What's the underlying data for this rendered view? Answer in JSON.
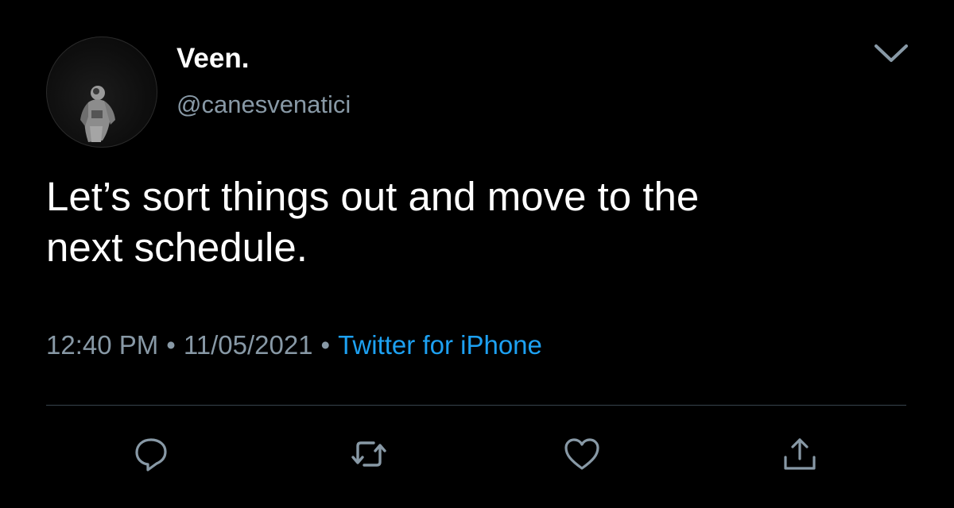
{
  "tweet": {
    "display_name": "Veen.",
    "handle": "@canesvenatici",
    "text_line1": "Let’s sort things out and move to the",
    "text_line2": "next schedule.",
    "time": "12:40 PM",
    "date": "11/05/2021",
    "separator": "•",
    "source": "Twitter for iPhone"
  },
  "icons": {
    "caret": "chevron-down-icon",
    "reply": "reply-icon",
    "retweet": "retweet-icon",
    "like": "heart-icon",
    "share": "share-icon"
  },
  "colors": {
    "background": "#000000",
    "primary_text": "#ffffff",
    "secondary_text": "#8899a6",
    "link": "#1da1f2",
    "divider": "#38444d"
  }
}
